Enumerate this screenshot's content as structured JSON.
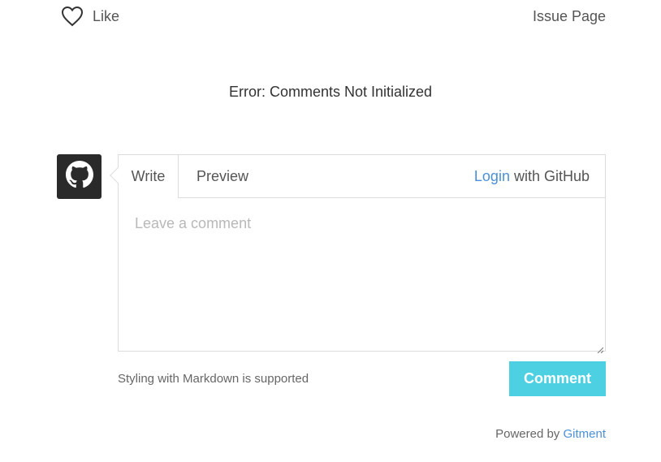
{
  "header": {
    "like_label": "Like",
    "issue_link": "Issue Page"
  },
  "error_message": "Error: Comments Not Initialized",
  "editor": {
    "tab_write": "Write",
    "tab_preview": "Preview",
    "login_link": "Login",
    "login_suffix": " with GitHub",
    "placeholder": "Leave a comment",
    "value": ""
  },
  "footer": {
    "markdown_tip": "Styling with Markdown is supported",
    "comment_button": "Comment",
    "powered_prefix": "Powered by ",
    "powered_link": "Gitment"
  },
  "icons": {
    "like": "heart-icon",
    "avatar": "github-icon"
  },
  "colors": {
    "accent": "#4a90d9",
    "button": "#4dd0e1",
    "avatar_bg": "#2a2a2a"
  }
}
